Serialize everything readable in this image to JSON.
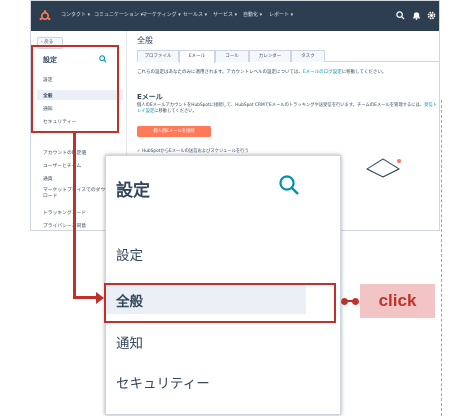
{
  "topnav": {
    "items": [
      "コンタクト ▾",
      "コミュニケーション ▾",
      "マーケティング ▾",
      "セールス ▾",
      "サービス ▾",
      "自動化 ▾",
      "レポート ▾"
    ],
    "icons": [
      "search-icon",
      "bell-icon",
      "gear-icon"
    ]
  },
  "sidebar": {
    "back_label": "‹ 戻る",
    "title": "設定",
    "items": [
      {
        "label": "設定",
        "active": false
      },
      {
        "label": "全般",
        "active": true
      },
      {
        "label": "通知",
        "active": false
      },
      {
        "label": "セキュリティー",
        "active": false
      }
    ],
    "sub_items": [
      {
        "label": "アカウントの既定値"
      },
      {
        "label": "ユーザーとチーム"
      },
      {
        "label": "通貨"
      },
      {
        "label": "マーケットプレイスでのダウンロード"
      },
      {
        "label": "トラッキングコード"
      },
      {
        "label": "プライバシーと同意"
      }
    ]
  },
  "content": {
    "title": "全般",
    "tabs": [
      {
        "label": "プロファイル",
        "active": false
      },
      {
        "label": "Eメール",
        "active": true
      },
      {
        "label": "コール",
        "active": false
      },
      {
        "label": "カレンダー",
        "active": false
      },
      {
        "label": "タスク",
        "active": false
      }
    ],
    "note_prefix": "これらの設定はあなたのみに適用されます。アカウントレベルの設定については、",
    "note_link": "Eメールのログ設定",
    "note_suffix": "に移動してください。",
    "section_title": "Eメール",
    "section_desc_1": "個人のEメールアカウントをHubSpotに接続して、HubSpot CRMでEメールのトラッキングや送受信を行います。チームのEメールを管理するには、",
    "section_desc_link": "受信トレイ設定",
    "section_desc_2": "に移動してください。",
    "connect_button": "個人用Eメールを接続",
    "check_item": "✓ HubSpotからEメールの送信およびスケジュールを行う"
  },
  "zoom": {
    "title": "設定",
    "items": [
      {
        "label": "設定",
        "active": false
      },
      {
        "label": "全般",
        "active": true
      },
      {
        "label": "通知",
        "active": false
      },
      {
        "label": "セキュリティー",
        "active": false
      }
    ]
  },
  "callout": {
    "label": "click"
  },
  "colors": {
    "accent_red": "#c0312b",
    "hubspot_orange": "#ff7a59",
    "nav_bg": "#2d3e50",
    "link": "#0091ae",
    "active_bg": "#eaf0f6"
  }
}
